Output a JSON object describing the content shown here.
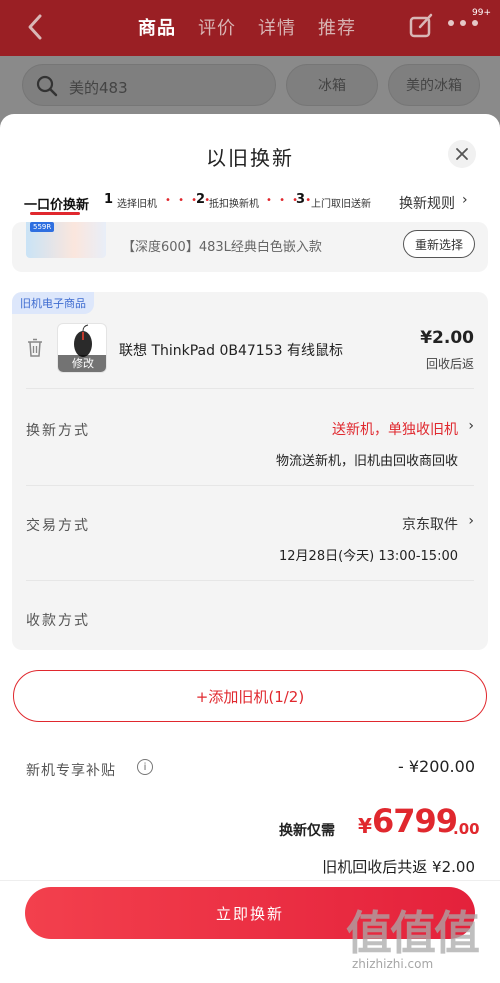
{
  "header": {
    "tabs": [
      "商品",
      "评价",
      "详情",
      "推荐"
    ],
    "active_tab": 0,
    "badge": "99+",
    "icons": [
      "back-arrow-icon",
      "share-icon",
      "more-dots-icon"
    ]
  },
  "search": {
    "query": "美的483",
    "chips": [
      "冰箱",
      "美的冰箱"
    ]
  },
  "sheet": {
    "title": "以旧换新",
    "steps": {
      "main": "一口价换新",
      "items": [
        {
          "num": "1",
          "label": "选择旧机"
        },
        {
          "num": "2",
          "label": "抵扣换新机"
        },
        {
          "num": "3",
          "label": "上门取旧送新"
        }
      ],
      "rules_label": "换新规则",
      "rules_arrow": "›"
    },
    "new_product": {
      "thumb_tag": "559R",
      "name": "【深度600】483L经典白色嵌入款",
      "reselect_label": "重新选择"
    },
    "old_device": {
      "tag": "旧机电子商品",
      "image_overlay": "修改",
      "name": "联想 ThinkPad 0B47153 有线鼠标",
      "price": "¥2.00",
      "price_hint": "回收后返",
      "rows": [
        {
          "label": "换新方式",
          "value": "送新机，单独收旧机",
          "sub": "物流送新机，旧机由回收商回收",
          "arrow": "›"
        },
        {
          "label": "交易方式",
          "value": "京东取件",
          "sub": "12月28日(今天) 13:00-15:00",
          "arrow": "›"
        },
        {
          "label": "收款方式",
          "value": "",
          "sub": "",
          "arrow": ""
        }
      ]
    },
    "add_button": "+添加旧机(1/2)",
    "subsidy": {
      "label": "新机专享补贴",
      "info": "i",
      "value": "- ¥200.00"
    },
    "total": {
      "label": "换新仅需",
      "currency": "¥",
      "integer": "6799",
      "decimal": ".00"
    },
    "refund_text": "旧机回收后共返 ¥2.00",
    "submit_label": "立即换新"
  },
  "watermark": {
    "glyphs": "值值值",
    "site": "zhizhizhi.com"
  },
  "colors": {
    "brand_red": "#e0282e",
    "header_red": "#9a1f24",
    "tag_blue": "#3d6bd0"
  }
}
